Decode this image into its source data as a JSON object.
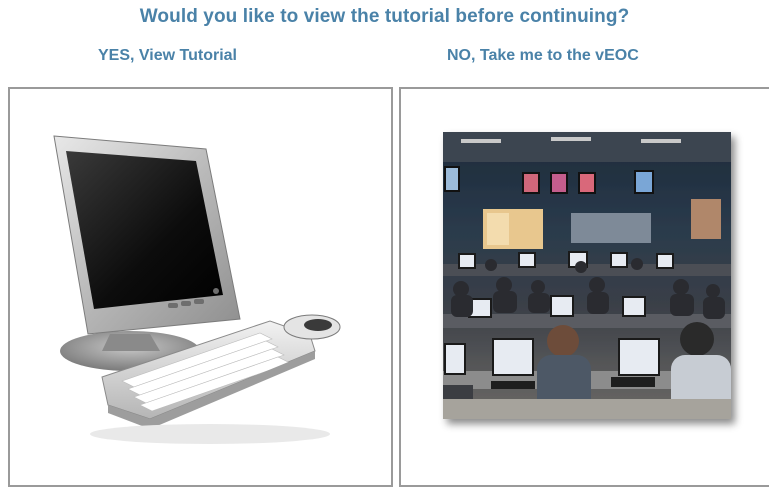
{
  "prompt": {
    "question": "Would you like to view the tutorial before continuing?"
  },
  "options": {
    "yes_label": "YES, View Tutorial",
    "no_label": "NO, Take me to the vEOC"
  },
  "colors": {
    "accent": "#4a82a8",
    "panel_border": "#9a9a9a"
  }
}
